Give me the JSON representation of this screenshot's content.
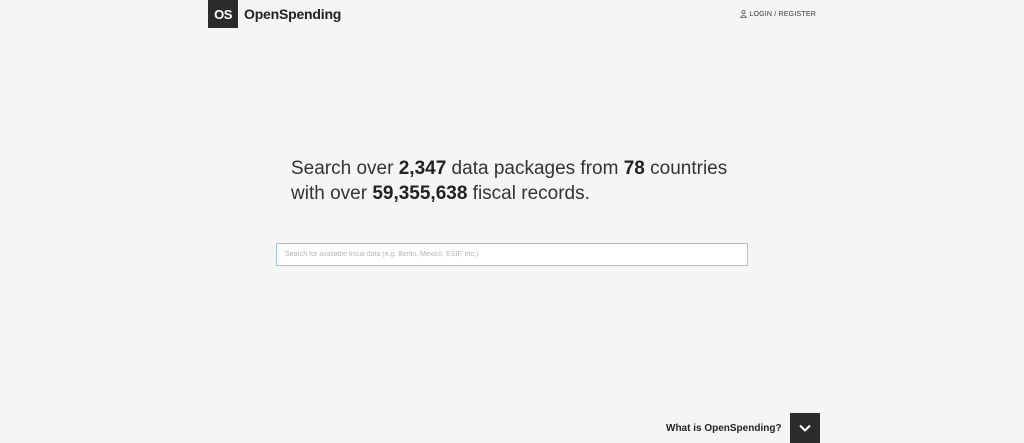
{
  "header": {
    "logo_text": "OS",
    "brand_name": "OpenSpending",
    "login_label": "LOGIN / REGISTER"
  },
  "headline": {
    "line1_pre": "Search over ",
    "packages_count": "2,347",
    "line1_mid": " data packages from ",
    "countries_count": "78",
    "line1_post": " countries",
    "line2_pre": "with over ",
    "records_count": "59,355,638",
    "line2_post": " fiscal records."
  },
  "search": {
    "placeholder": "Search for available fiscal data (e.g. Berlin, Mexico, ESIF, etc.)",
    "value": ""
  },
  "cta": {
    "label": "What is OpenSpending?",
    "icon": "chevron-down-icon"
  },
  "colors": {
    "background": "#f5f5f5",
    "dark": "#2b2b2b",
    "search_border": "#9cc6d6"
  }
}
